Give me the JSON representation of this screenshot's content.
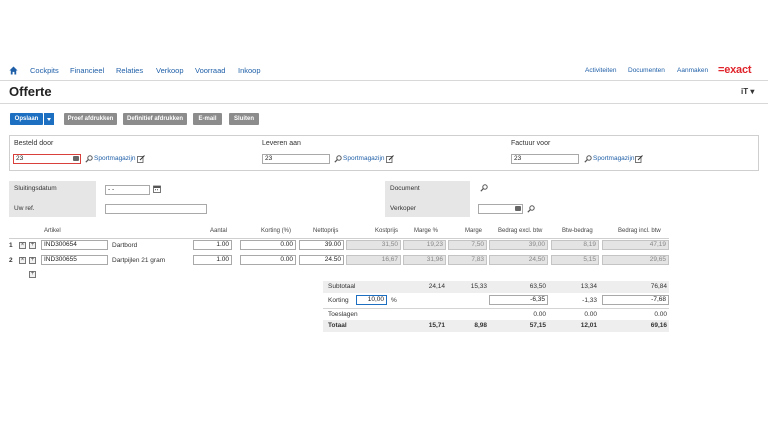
{
  "nav": {
    "items": [
      "Cockpits",
      "Financieel",
      "Relaties",
      "Verkoop",
      "Voorraad",
      "Inkoop"
    ],
    "right": [
      "Activiteiten",
      "Documenten",
      "Aanmaken"
    ],
    "logo": "=exact"
  },
  "page": {
    "title": "Offerte",
    "lang": "iT ▾"
  },
  "toolbar": {
    "save": "Opslaan",
    "proof_print": "Proef afdrukken",
    "final_print": "Definitief afdrukken",
    "email": "E-mail",
    "close": "Sluiten"
  },
  "order": {
    "ordered_by_label": "Besteld door",
    "deliver_to_label": "Leveren aan",
    "invoice_to_label": "Factuur voor",
    "ordered_by_value": "23",
    "deliver_to_value": "23",
    "invoice_to_value": "23",
    "company": "Sportmagazijn"
  },
  "details": {
    "closing_date_label": "Sluitingsdatum",
    "closing_date_value": "- -",
    "your_ref_label": "Uw ref.",
    "your_ref_value": "",
    "document_label": "Document",
    "seller_label": "Verkoper",
    "seller_value": ""
  },
  "grid": {
    "headers": {
      "artikel": "Artikel",
      "aantal": "Aantal",
      "korting": "Korting (%)",
      "nettoprijs": "Nettoprijs",
      "kostprijs": "Kostprijs",
      "marge_pct": "Marge %",
      "marge": "Marge",
      "bedrag_excl": "Bedrag excl. btw",
      "btw": "Btw-bedrag",
      "bedrag_incl": "Bedrag incl. btw"
    },
    "rows": [
      {
        "nr": "1",
        "code": "IND300654",
        "desc": "Dartbord",
        "aantal": "1.00",
        "korting": "0.00",
        "nettoprijs": "39.00",
        "kostprijs": "31,50",
        "marge_pct": "19,23",
        "marge": "7,50",
        "bedrag_excl": "39,00",
        "btw": "8,19",
        "bedrag_incl": "47,19"
      },
      {
        "nr": "2",
        "code": "IND300655",
        "desc": "Dartpijlen 21 gram",
        "aantal": "1.00",
        "korting": "0.00",
        "nettoprijs": "24.50",
        "kostprijs": "16,67",
        "marge_pct": "31,96",
        "marge": "7,83",
        "bedrag_excl": "24,50",
        "btw": "5,15",
        "bedrag_incl": "29,65"
      }
    ],
    "add_symbol": "+",
    "remove_symbol": "×"
  },
  "summary": {
    "subtotal_label": "Subtotaal",
    "subtotal_marge_pct": "24,14",
    "subtotal_marge": "15,33",
    "subtotal_excl": "63,50",
    "subtotal_btw": "13,34",
    "subtotal_incl": "76,84",
    "discount_label": "Korting",
    "discount_value": "10,00",
    "discount_unit": "%",
    "discount_excl": "-6,35",
    "discount_btw": "-1,33",
    "discount_incl": "-7,68",
    "surcharge_label": "Toeslagen",
    "surcharge_excl": "0.00",
    "surcharge_btw": "0.00",
    "surcharge_incl": "0.00",
    "total_label": "Totaal",
    "total_marge_pct": "15,71",
    "total_marge": "8,98",
    "total_excl": "57,15",
    "total_btw": "12,01",
    "total_incl": "69,16"
  },
  "colors": {
    "accent": "#1d6fc1",
    "link": "#1f5fa8",
    "brand": "#e0242b",
    "button_gray": "#8c8c8c"
  },
  "icons": [
    "home-icon",
    "calendar-icon",
    "search-icon",
    "edit-icon",
    "add-icon",
    "remove-icon"
  ]
}
